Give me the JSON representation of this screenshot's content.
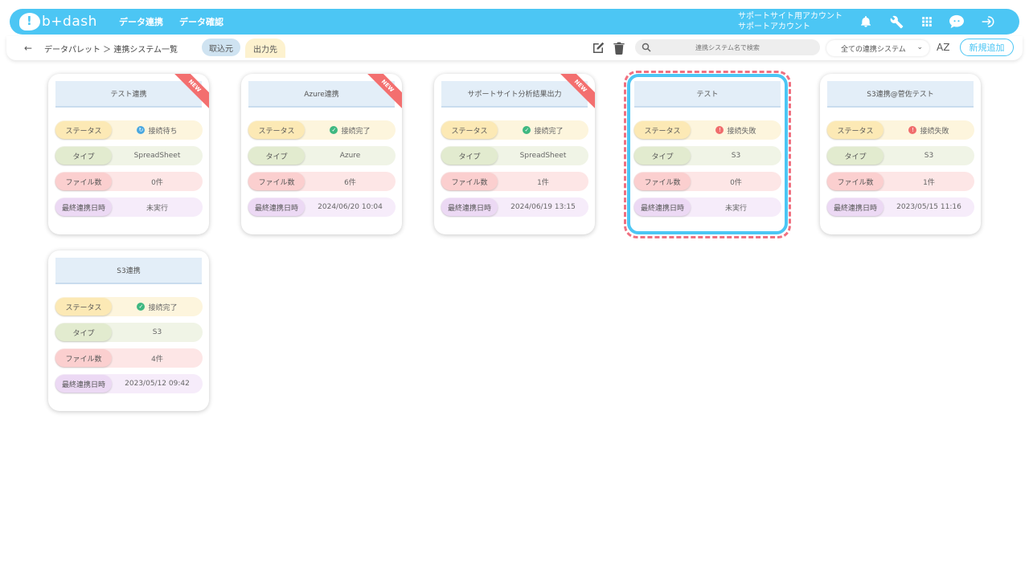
{
  "header": {
    "logo_text": "b+dash",
    "nav": [
      "データ連携",
      "データ確認"
    ],
    "account_line1": "サポートサイト用アカウント",
    "account_line2": "サポートアカウント",
    "icons": [
      "bell-icon",
      "wrench-icon",
      "grid-icon",
      "chat-icon",
      "logout-icon"
    ]
  },
  "subbar": {
    "back": "←",
    "breadcrumb": "データパレット ＞ 連携システム一覧",
    "tab_in": "取込元",
    "tab_out": "出力先",
    "search_placeholder": "連携システム名で検索",
    "select_value": "全ての連携システム",
    "sort_label": "AZ",
    "add_label": "新規追加"
  },
  "labels": {
    "status": "ステータス",
    "type": "タイプ",
    "files": "ファイル数",
    "last": "最終連携日時",
    "new": "NEW"
  },
  "cards": [
    {
      "title": "テスト連携",
      "status": "接続待ち",
      "status_kind": "wait",
      "type": "SpreadSheet",
      "files": "0件",
      "last": "未実行",
      "new": true
    },
    {
      "title": "Azure連携",
      "status": "接続完了",
      "status_kind": "ok",
      "type": "Azure",
      "files": "6件",
      "last": "2024/06/20 10:04",
      "new": true
    },
    {
      "title": "サポートサイト分析結果出力",
      "status": "接続完了",
      "status_kind": "ok",
      "type": "SpreadSheet",
      "files": "1件",
      "last": "2024/06/19 13:15",
      "new": true
    },
    {
      "title": "テスト",
      "status": "接続失敗",
      "status_kind": "err",
      "type": "S3",
      "files": "0件",
      "last": "未実行",
      "new": false,
      "selected": true
    },
    {
      "title": "S3連携@菅佐テスト",
      "status": "接続失敗",
      "status_kind": "err",
      "type": "S3",
      "files": "1件",
      "last": "2023/05/15 11:16",
      "new": false
    },
    {
      "title": "S3連携",
      "status": "接続完了",
      "status_kind": "ok",
      "type": "S3",
      "files": "4件",
      "last": "2023/05/12 09:42",
      "new": false
    }
  ],
  "colors": {
    "accent": "#4cc6f4",
    "new_ribbon": "#f36f6f",
    "selected_dash": "#f07080"
  }
}
